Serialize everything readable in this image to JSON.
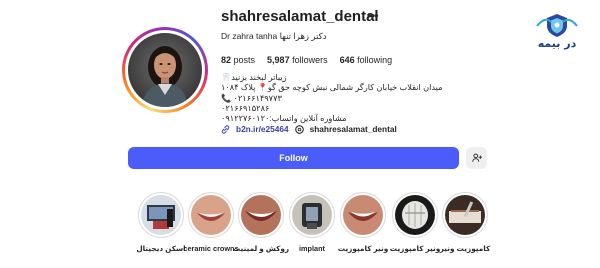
{
  "watermark": {
    "text": "در بیمه",
    "icon": "shield-icon"
  },
  "profile": {
    "username": "shahresalamat_dental",
    "more_icon": "ellipsis-icon",
    "full_name": "Dr zahra tanha دکتر زهرا تنها",
    "stats": {
      "posts_count": "82",
      "posts_label": "posts",
      "followers_count": "5,987",
      "followers_label": "followers",
      "following_count": "646",
      "following_label": "following"
    },
    "bio_lines": [
      "زیباتر لبخند بزنید🦷",
      "میدان انقلاب خیابان کارگر شمالی نبش کوچه حق گو📍 پلاک ۱۰۸۴",
      "۰۲۱۶۶۱۴۹۷۷۳ 📞",
      "۰۲۱۶۶۹۱۵۲۸۶",
      "مشاوره آنلاین واتساپ:۰۹۱۲۲۷۶۰۱۲۰"
    ],
    "link_text": "b2n.ir/e25464",
    "threads_handle": "shahresalamat_dental"
  },
  "actions": {
    "follow_label": "Follow",
    "add_user_icon": "person-add-icon"
  },
  "highlights": [
    {
      "label": "اسکن دیجیتال",
      "icon": "scan-photo"
    },
    {
      "label": "ceramic crowns",
      "icon": "smile-photo"
    },
    {
      "label": "روکش و لمینیت",
      "icon": "smile-photo"
    },
    {
      "label": "implant",
      "icon": "implant-photo"
    },
    {
      "label": "ونیر کامپوزیت",
      "icon": "smile-photo"
    },
    {
      "label": "ونیر کامپوزیت",
      "icon": "veneer-photo"
    },
    {
      "label": "کامپوزیت ونیر",
      "icon": "treatment-photo"
    }
  ]
}
